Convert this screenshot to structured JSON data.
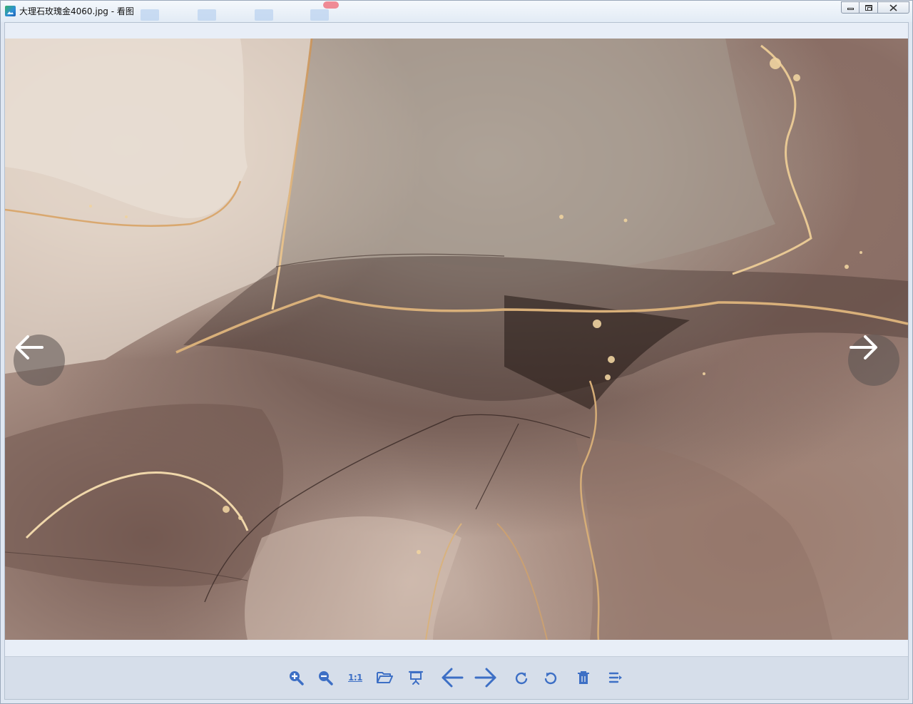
{
  "window": {
    "title": "大理石玫瑰金4060.jpg - 看图"
  },
  "icons": {
    "app": "image-viewer-app-icon",
    "minimize": "minimize-icon",
    "maximize": "restore-icon",
    "close": "close-icon",
    "prev": "arrow-left-icon",
    "next": "arrow-right-icon"
  },
  "toolbar": {
    "actual_size_label": "1:1",
    "items": [
      "zoom-in",
      "zoom-out",
      "actual-size",
      "open-folder",
      "slideshow",
      "previous",
      "next",
      "rotate-clockwise",
      "rotate-counterclockwise",
      "delete",
      "more"
    ]
  },
  "colors": {
    "accent": "#3d6fc5",
    "toolbar_bg": "#d6deea",
    "marble_gold": "#d9b07a"
  }
}
